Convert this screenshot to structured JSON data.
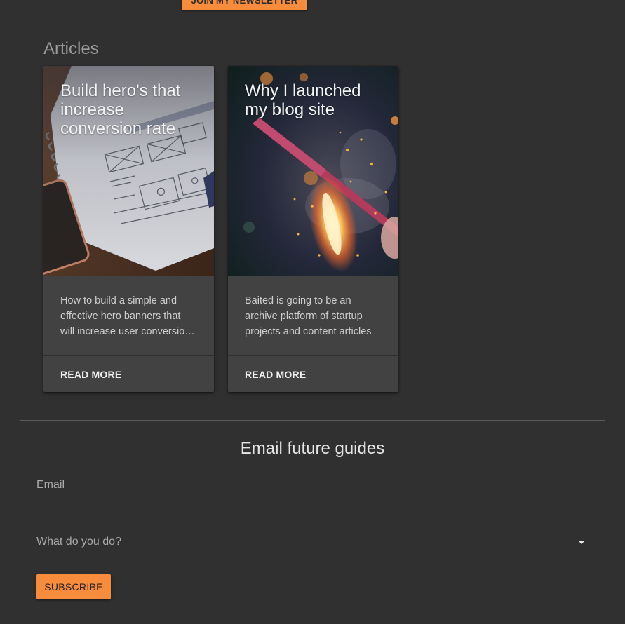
{
  "header": {
    "newsletter_button_label": "JOIN MY NEWSLETTER"
  },
  "articles": {
    "section_title": "Articles",
    "items": [
      {
        "title": "Build hero's that increase conversion rate",
        "excerpt": "How to build a simple and effective hero banners that will increase user conversion rates",
        "action_label": "READ MORE",
        "image_icon": "notebook-wireframe-image"
      },
      {
        "title": "Why I launched my blog site",
        "excerpt": "Baited is going to be an archive platform of startup projects and content articles",
        "action_label": "READ MORE",
        "image_icon": "sparkler-image"
      }
    ]
  },
  "subscribe_form": {
    "title": "Email future guides",
    "email_placeholder": "Email",
    "role_placeholder": "What do you do?",
    "submit_label": "SUBSCRIBE"
  },
  "colors": {
    "background": "#303030",
    "card": "#424242",
    "accent": "#f68c3c"
  }
}
